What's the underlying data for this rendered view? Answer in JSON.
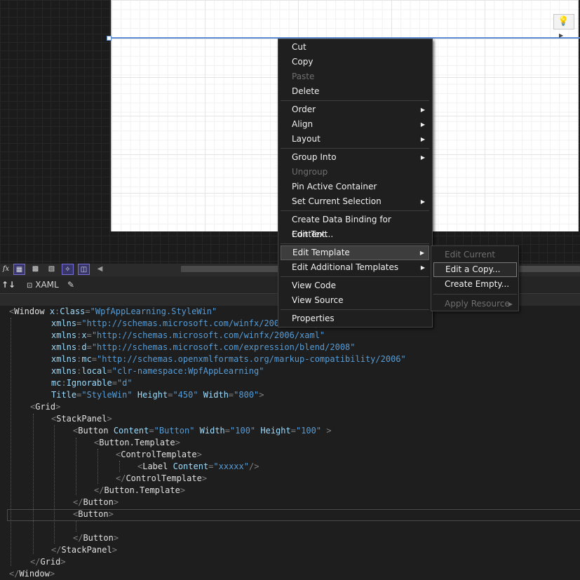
{
  "context_menu": {
    "groups": [
      [
        {
          "label": "Cut",
          "enabled": true,
          "submenu": false
        },
        {
          "label": "Copy",
          "enabled": true,
          "submenu": false
        },
        {
          "label": "Paste",
          "enabled": false,
          "submenu": false
        },
        {
          "label": "Delete",
          "enabled": true,
          "submenu": false
        }
      ],
      [
        {
          "label": "Order",
          "enabled": true,
          "submenu": true
        },
        {
          "label": "Align",
          "enabled": true,
          "submenu": true
        },
        {
          "label": "Layout",
          "enabled": true,
          "submenu": true
        }
      ],
      [
        {
          "label": "Group Into",
          "enabled": true,
          "submenu": true
        },
        {
          "label": "Ungroup",
          "enabled": false,
          "submenu": false
        },
        {
          "label": "Pin Active Container",
          "enabled": true,
          "submenu": false
        },
        {
          "label": "Set Current Selection",
          "enabled": true,
          "submenu": true
        }
      ],
      [
        {
          "label": "Create Data Binding for Content...",
          "enabled": true,
          "submenu": false
        },
        {
          "label": "Edit Text",
          "enabled": true,
          "submenu": false
        }
      ],
      [
        {
          "label": "Edit Template",
          "enabled": true,
          "submenu": true,
          "highlighted": true
        },
        {
          "label": "Edit Additional Templates",
          "enabled": true,
          "submenu": true
        }
      ],
      [
        {
          "label": "View Code",
          "enabled": true,
          "submenu": false
        },
        {
          "label": "View Source",
          "enabled": true,
          "submenu": false
        }
      ],
      [
        {
          "label": "Properties",
          "enabled": true,
          "submenu": false
        }
      ]
    ]
  },
  "submenu": {
    "items": [
      {
        "label": "Edit Current",
        "enabled": false,
        "submenu": false
      },
      {
        "label": "Edit a Copy...",
        "enabled": true,
        "submenu": false,
        "highlighted": true
      },
      {
        "label": "Create Empty...",
        "enabled": true,
        "submenu": false
      },
      {
        "label": "Apply Resource",
        "enabled": false,
        "submenu": true,
        "separator_before": true
      }
    ]
  },
  "toolbar": {
    "fx_label": "fx",
    "swap_label": "↑↓",
    "xaml_tab": "XAML",
    "colors": {
      "active_border": "#7a6fd6"
    }
  },
  "code": {
    "lines": [
      {
        "indent": 0,
        "tokens": [
          [
            "pn",
            "<"
          ],
          [
            "nm",
            "Window "
          ],
          [
            "at",
            "x"
          ],
          [
            "pn",
            ":"
          ],
          [
            "at",
            "Class"
          ],
          [
            "pn",
            "="
          ],
          [
            "vl",
            "\"WpfAppLearning.StyleWin\""
          ]
        ]
      },
      {
        "indent": 1,
        "tokens": [
          [
            "at",
            "xmlns"
          ],
          [
            "pn",
            "="
          ],
          [
            "vl",
            "\"http://schemas.microsoft.com/winfx/2006/xaml/presentation\""
          ]
        ]
      },
      {
        "indent": 1,
        "tokens": [
          [
            "at",
            "xmlns"
          ],
          [
            "pn",
            ":"
          ],
          [
            "at",
            "x"
          ],
          [
            "pn",
            "="
          ],
          [
            "vl",
            "\"http://schemas.microsoft.com/winfx/2006/xaml\""
          ]
        ]
      },
      {
        "indent": 1,
        "tokens": [
          [
            "at",
            "xmlns"
          ],
          [
            "pn",
            ":"
          ],
          [
            "at",
            "d"
          ],
          [
            "pn",
            "="
          ],
          [
            "vl",
            "\"http://schemas.microsoft.com/expression/blend/2008\""
          ]
        ]
      },
      {
        "indent": 1,
        "tokens": [
          [
            "at",
            "xmlns"
          ],
          [
            "pn",
            ":"
          ],
          [
            "at",
            "mc"
          ],
          [
            "pn",
            "="
          ],
          [
            "vl",
            "\"http://schemas.openxmlformats.org/markup-compatibility/2006\""
          ]
        ]
      },
      {
        "indent": 1,
        "tokens": [
          [
            "at",
            "xmlns"
          ],
          [
            "pn",
            ":"
          ],
          [
            "at",
            "local"
          ],
          [
            "pn",
            "="
          ],
          [
            "vl",
            "\"clr-namespace:WpfAppLearning\""
          ]
        ]
      },
      {
        "indent": 1,
        "tokens": [
          [
            "at",
            "mc"
          ],
          [
            "pn",
            ":"
          ],
          [
            "at",
            "Ignorable"
          ],
          [
            "pn",
            "="
          ],
          [
            "vl",
            "\"d\""
          ]
        ]
      },
      {
        "indent": 1,
        "tokens": [
          [
            "at",
            "Title"
          ],
          [
            "pn",
            "="
          ],
          [
            "vl",
            "\"StyleWin\" "
          ],
          [
            "at",
            "Height"
          ],
          [
            "pn",
            "="
          ],
          [
            "vl",
            "\"450\" "
          ],
          [
            "at",
            "Width"
          ],
          [
            "pn",
            "="
          ],
          [
            "vl",
            "\"800\""
          ],
          [
            "pn",
            ">"
          ]
        ]
      },
      {
        "indent": 2,
        "tokens": [
          [
            "pn",
            "<"
          ],
          [
            "nm",
            "Grid"
          ],
          [
            "pn",
            ">"
          ]
        ]
      },
      {
        "indent": 3,
        "tokens": [
          [
            "pn",
            "<"
          ],
          [
            "nm",
            "StackPanel"
          ],
          [
            "pn",
            ">"
          ]
        ]
      },
      {
        "indent": 4,
        "tokens": [
          [
            "pn",
            "<"
          ],
          [
            "nm",
            "Button "
          ],
          [
            "at",
            "Content"
          ],
          [
            "pn",
            "="
          ],
          [
            "vl",
            "\"Button\" "
          ],
          [
            "at",
            "Width"
          ],
          [
            "pn",
            "="
          ],
          [
            "vl",
            "\"100\" "
          ],
          [
            "at",
            "Height"
          ],
          [
            "pn",
            "="
          ],
          [
            "vl",
            "\"100\" "
          ],
          [
            "pn",
            ">"
          ]
        ]
      },
      {
        "indent": 5,
        "tokens": [
          [
            "pn",
            "<"
          ],
          [
            "nm",
            "Button.Template"
          ],
          [
            "pn",
            ">"
          ]
        ]
      },
      {
        "indent": 6,
        "tokens": [
          [
            "pn",
            "<"
          ],
          [
            "nm",
            "ControlTemplate"
          ],
          [
            "pn",
            ">"
          ]
        ]
      },
      {
        "indent": 7,
        "tokens": [
          [
            "pn",
            "<"
          ],
          [
            "nm",
            "Label "
          ],
          [
            "at",
            "Content"
          ],
          [
            "pn",
            "="
          ],
          [
            "vl",
            "\"xxxxx\""
          ],
          [
            "pn",
            "/>"
          ]
        ]
      },
      {
        "indent": 6,
        "tokens": [
          [
            "pn",
            "</"
          ],
          [
            "nm",
            "ControlTemplate"
          ],
          [
            "pn",
            ">"
          ]
        ]
      },
      {
        "indent": 5,
        "tokens": [
          [
            "pn",
            "</"
          ],
          [
            "nm",
            "Button.Template"
          ],
          [
            "pn",
            ">"
          ]
        ]
      },
      {
        "indent": 4,
        "tokens": [
          [
            "pn",
            "</"
          ],
          [
            "nm",
            "Button"
          ],
          [
            "pn",
            ">"
          ]
        ]
      },
      {
        "indent": 4,
        "tokens": [
          [
            "pn",
            "<"
          ],
          [
            "nm",
            "Button"
          ],
          [
            "pn",
            ">"
          ]
        ]
      },
      {
        "indent": 4,
        "tokens": []
      },
      {
        "indent": 4,
        "tokens": [
          [
            "pn",
            "</"
          ],
          [
            "nm",
            "Button"
          ],
          [
            "pn",
            ">"
          ]
        ]
      },
      {
        "indent": 3,
        "tokens": [
          [
            "pn",
            "</"
          ],
          [
            "nm",
            "StackPanel"
          ],
          [
            "pn",
            ">"
          ]
        ]
      },
      {
        "indent": 2,
        "tokens": [
          [
            "pn",
            "</"
          ],
          [
            "nm",
            "Grid"
          ],
          [
            "pn",
            ">"
          ]
        ]
      },
      {
        "indent": 0,
        "tokens": [
          [
            "pn",
            "</"
          ],
          [
            "nm",
            "Window"
          ],
          [
            "pn",
            ">"
          ]
        ]
      }
    ]
  }
}
